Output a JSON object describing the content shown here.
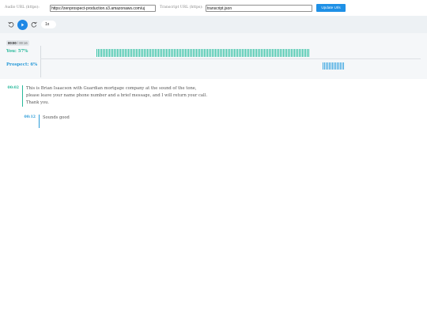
{
  "url_bar": {
    "audio_label": "Audio URL (https):",
    "audio_value": "https://zenprospect-production.s3.amazonaws.com/uj",
    "transcript_label": "Transcript URL (https):",
    "transcript_value": "transcript.json",
    "update_button": "Update Urls"
  },
  "controls": {
    "rewind_icon": "rewind-icon",
    "play_icon": "play-icon",
    "forward_icon": "forward-icon",
    "speed": "1x"
  },
  "timeline": {
    "current_time": "00:00",
    "separator": " / ",
    "total_time": "00:16",
    "speakers": [
      {
        "label": "You: 57%",
        "color": "#26b89a"
      },
      {
        "label": "Prospect: 6%",
        "color": "#2b9bd8"
      }
    ]
  },
  "transcript": [
    {
      "speaker": "you",
      "time": "00:02",
      "lines": [
        "This is Brian Isaacson with Guardian mortgage company at the sound of the tone,",
        "please leave your name phone number and a brief message, and I will return your call.",
        "Thank you."
      ]
    },
    {
      "speaker": "prospect",
      "time": "00:12",
      "lines": [
        "Sounds good"
      ]
    }
  ]
}
